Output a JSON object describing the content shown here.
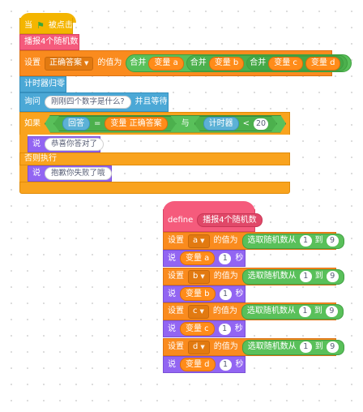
{
  "script1": {
    "hat": {
      "when": "当",
      "flag_icon": "green-flag-icon",
      "clicked": "被点击"
    },
    "broadcast_custom": "播报4个随机数",
    "set_answer": {
      "set": "设置",
      "var": "正确答案",
      "to": "的值为",
      "join": "合并",
      "a": "变量 a",
      "b": "变量 b",
      "c": "变量 c",
      "d": "变量 d"
    },
    "reset_timer": "计时器归零",
    "ask": {
      "ask": "询问",
      "question": "刚刚四个数字是什么?",
      "and_wait": "并且等待"
    },
    "if_block": {
      "if": "如果",
      "answer": "回答",
      "eq": "=",
      "correct": "变量 正确答案",
      "and": "与",
      "timer": "计时器",
      "lt": "<",
      "limit": "20",
      "then": "那么执行"
    },
    "say_correct": {
      "say": "说",
      "text": "恭喜你答对了"
    },
    "else": "否则执行",
    "say_wrong": {
      "say": "说",
      "text": "抱歉你失败了哦"
    }
  },
  "script2": {
    "define": "define",
    "name": "播报4个随机数",
    "rows": [
      {
        "set": "设置",
        "var": "a",
        "to": "的值为",
        "random": "选取随机数从",
        "from": "1",
        "until": "到",
        "max": "9"
      },
      {
        "say": "说",
        "value": "变量 a",
        "secs": "1",
        "unit": "秒"
      },
      {
        "set": "设置",
        "var": "b",
        "to": "的值为",
        "random": "选取随机数从",
        "from": "1",
        "until": "到",
        "max": "9"
      },
      {
        "say": "说",
        "value": "变量 b",
        "secs": "1",
        "unit": "秒"
      },
      {
        "set": "设置",
        "var": "c",
        "to": "的值为",
        "random": "选取随机数从",
        "from": "1",
        "until": "到",
        "max": "9"
      },
      {
        "say": "说",
        "value": "变量 c",
        "secs": "1",
        "unit": "秒"
      },
      {
        "set": "设置",
        "var": "d",
        "to": "的值为",
        "random": "选取随机数从",
        "from": "1",
        "until": "到",
        "max": "9"
      },
      {
        "say": "说",
        "value": "变量 d",
        "secs": "1",
        "unit": "秒"
      }
    ]
  },
  "colors": {
    "events": "#f4b500",
    "looks": "#9265f2",
    "data": "#fa8b1e",
    "sensing": "#4ba8d6",
    "control": "#f9a31e",
    "custom": "#f55b7c",
    "operators": "#59c05a"
  }
}
